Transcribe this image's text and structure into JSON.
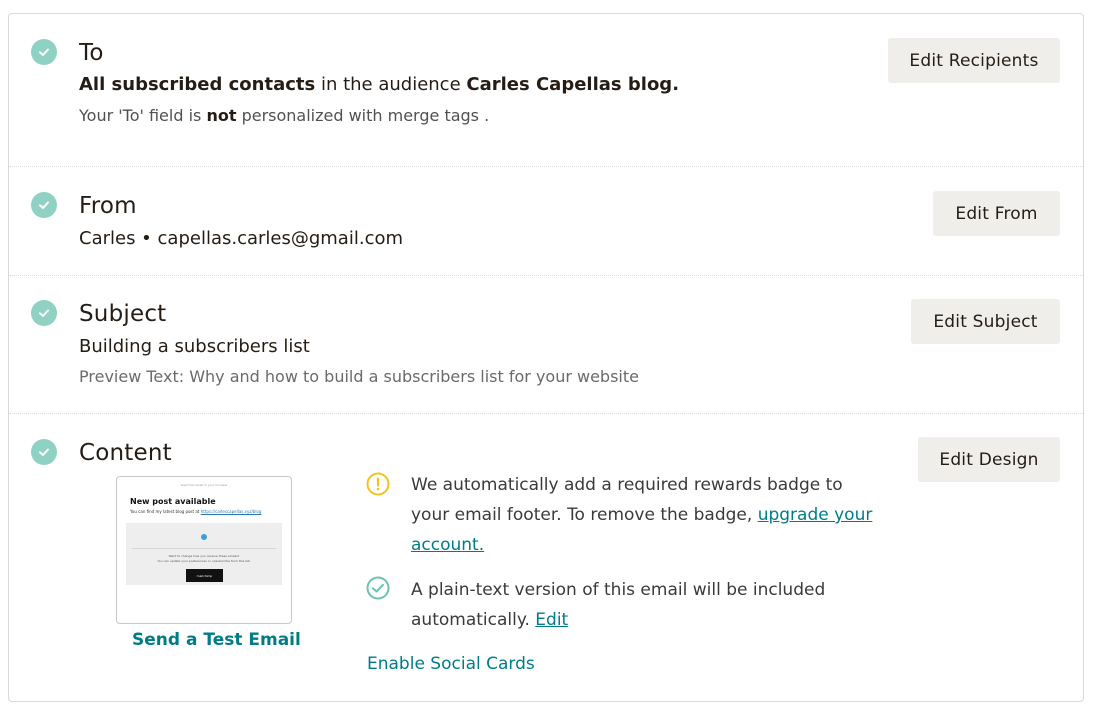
{
  "to": {
    "title": "To",
    "audience_prefix": "All subscribed contacts",
    "audience_mid": " in the audience ",
    "audience_name": "Carles Capellas blog.",
    "note_prefix": "Your 'To' field is ",
    "note_bold": "not",
    "note_suffix": " personalized with merge tags .",
    "button": "Edit Recipients"
  },
  "from": {
    "title": "From",
    "value": "Carles • capellas.carles@gmail.com",
    "button": "Edit From"
  },
  "subject": {
    "title": "Subject",
    "value": "Building a subscribers list",
    "preview_text": "Preview Text: Why and how to build a subscribers list for your website",
    "button": "Edit Subject"
  },
  "content": {
    "title": "Content",
    "button": "Edit Design",
    "test_email": "Send a Test Email",
    "badge_note": "We automatically add a required rewards badge to your email footer. To remove the badge, ",
    "badge_link": "upgrade your account.",
    "plain_text_note": "A plain-text version of this email will be included automatically. ",
    "plain_text_link": "Edit",
    "social_cards": "Enable Social Cards",
    "preview": {
      "top_line": "View this email in your browser",
      "heading": "New post available",
      "body": "You can find my latest blog post at ",
      "body_link": "https://carlescapellas.xyz/blog",
      "footer_line1": "Want to change how you receive these emails?",
      "footer_line2": "You can update your preferences or unsubscribe from this list.",
      "badge": "mailchimp"
    }
  },
  "colors": {
    "check": "#8fd1c2",
    "warning": "#f2c31f",
    "link": "#007c89",
    "button_bg": "#efeeea"
  }
}
